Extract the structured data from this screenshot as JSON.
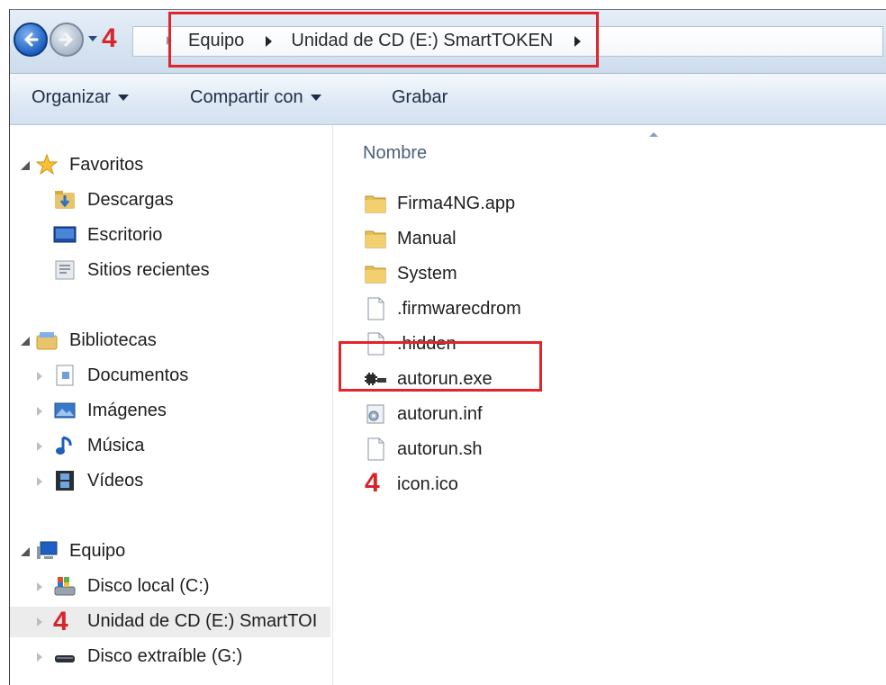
{
  "address": {
    "step_marker": "4",
    "breadcrumbs": [
      "Equipo",
      "Unidad de CD (E:) SmartTOKEN"
    ]
  },
  "toolbar": {
    "organize": "Organizar",
    "share": "Compartir con",
    "burn": "Grabar"
  },
  "sidebar": {
    "favorites": {
      "label": "Favoritos",
      "items": [
        "Descargas",
        "Escritorio",
        "Sitios recientes"
      ]
    },
    "libraries": {
      "label": "Bibliotecas",
      "items": [
        "Documentos",
        "Imágenes",
        "Música",
        "Vídeos"
      ]
    },
    "computer": {
      "label": "Equipo",
      "items": [
        "Disco local (C:)",
        "Unidad de CD (E:) SmartTOI",
        "Disco extraíble (G:)"
      ],
      "cd_marker": "4"
    }
  },
  "content": {
    "column_header": "Nombre",
    "files": [
      {
        "name": "Firma4NG.app",
        "icon": "folder-icon"
      },
      {
        "name": "Manual",
        "icon": "folder-icon"
      },
      {
        "name": "System",
        "icon": "folder-icon"
      },
      {
        "name": ".firmwarecdrom",
        "icon": "file-icon"
      },
      {
        "name": ".hidden",
        "icon": "file-icon"
      },
      {
        "name": "autorun.exe",
        "icon": "executable-icon"
      },
      {
        "name": "autorun.inf",
        "icon": "settings-file-icon"
      },
      {
        "name": "autorun.sh",
        "icon": "file-icon"
      },
      {
        "name": "icon.ico",
        "icon": "red-4-icon",
        "marker": "4"
      }
    ]
  },
  "colors": {
    "highlight": "#e0252b",
    "marker": "#d6262c"
  }
}
